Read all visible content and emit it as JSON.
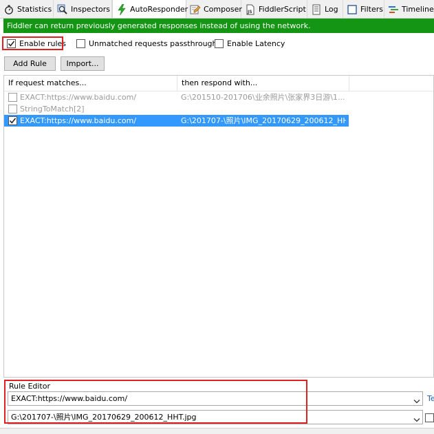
{
  "tabs": [
    {
      "label": "Statistics",
      "icon": "stopwatch-icon"
    },
    {
      "label": "Inspectors",
      "icon": "magnifier-icon"
    },
    {
      "label": "AutoResponder",
      "icon": "lightning-icon",
      "active": true
    },
    {
      "label": "Composer",
      "icon": "pencil-icon"
    },
    {
      "label": "FiddlerScript",
      "icon": "script-icon"
    },
    {
      "label": "Log",
      "icon": "log-icon"
    },
    {
      "label": "Filters",
      "icon": "filter-checkbox-icon"
    },
    {
      "label": "Timeline",
      "icon": "timeline-icon"
    }
  ],
  "banner": {
    "text": "Fiddler can return previously generated responses instead of using the network.",
    "color": "#149614"
  },
  "options": {
    "enable_rules": {
      "label": "Enable rules",
      "checked": true
    },
    "unmatched": {
      "label": "Unmatched requests passthrough",
      "checked": false
    },
    "latency": {
      "label": "Enable Latency",
      "checked": false
    }
  },
  "buttons": {
    "add_rule": "Add Rule",
    "import": "Import..."
  },
  "rules_table": {
    "columns": [
      "If request matches...",
      "then respond with..."
    ],
    "rows": [
      {
        "checked": false,
        "match": "EXACT:https://www.baidu.com/",
        "respond": "G:\\201510-201706\\业余照片\\张家界3日游\\1...",
        "state": "disabled"
      },
      {
        "checked": false,
        "match": "StringToMatch[2]",
        "respond": "",
        "state": "disabled"
      },
      {
        "checked": true,
        "match": "EXACT:https://www.baidu.com/",
        "respond": "G:\\201707-\\照片\\IMG_20170629_200612_HH...",
        "state": "selected"
      }
    ]
  },
  "rule_editor": {
    "label": "Rule Editor",
    "match_value": "EXACT:https://www.baidu.com/",
    "respond_value": "G:\\201707-\\照片\\IMG_20170629_200612_HHT.jpg",
    "test_link": "Te"
  },
  "colors": {
    "highlight_box": "#e02020",
    "selection": "#3399ff"
  }
}
